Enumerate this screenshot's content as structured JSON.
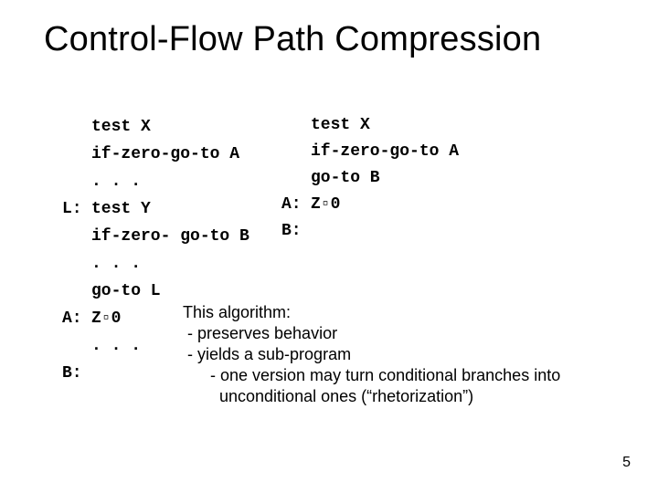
{
  "title": "Control-Flow Path Compression",
  "left": {
    "l0": "test X",
    "l1": "if-zero-go-to A",
    "l2": ". . .",
    "l3_label": "L:",
    "l3": "test Y",
    "l4": "if-zero- go-to B",
    "l5": ". . .",
    "l6": "go-to L",
    "l7_label": "A:",
    "l7": "Z▫0",
    "l8": ". . .",
    "l9_label": "B:"
  },
  "right": {
    "r0": "test X",
    "r1": "if-zero-go-to A",
    "r2": "go-to B",
    "r3_label": "A:",
    "r3": "Z▫0",
    "r4_label": "B:"
  },
  "algo": {
    "a0": "This algorithm:",
    "a1": " - preserves behavior",
    "a2": " - yields a sub-program",
    "a3": "      - one version may turn conditional branches into",
    "a4": "        unconditional ones (“rhetorization”)"
  },
  "pagenum": "5"
}
